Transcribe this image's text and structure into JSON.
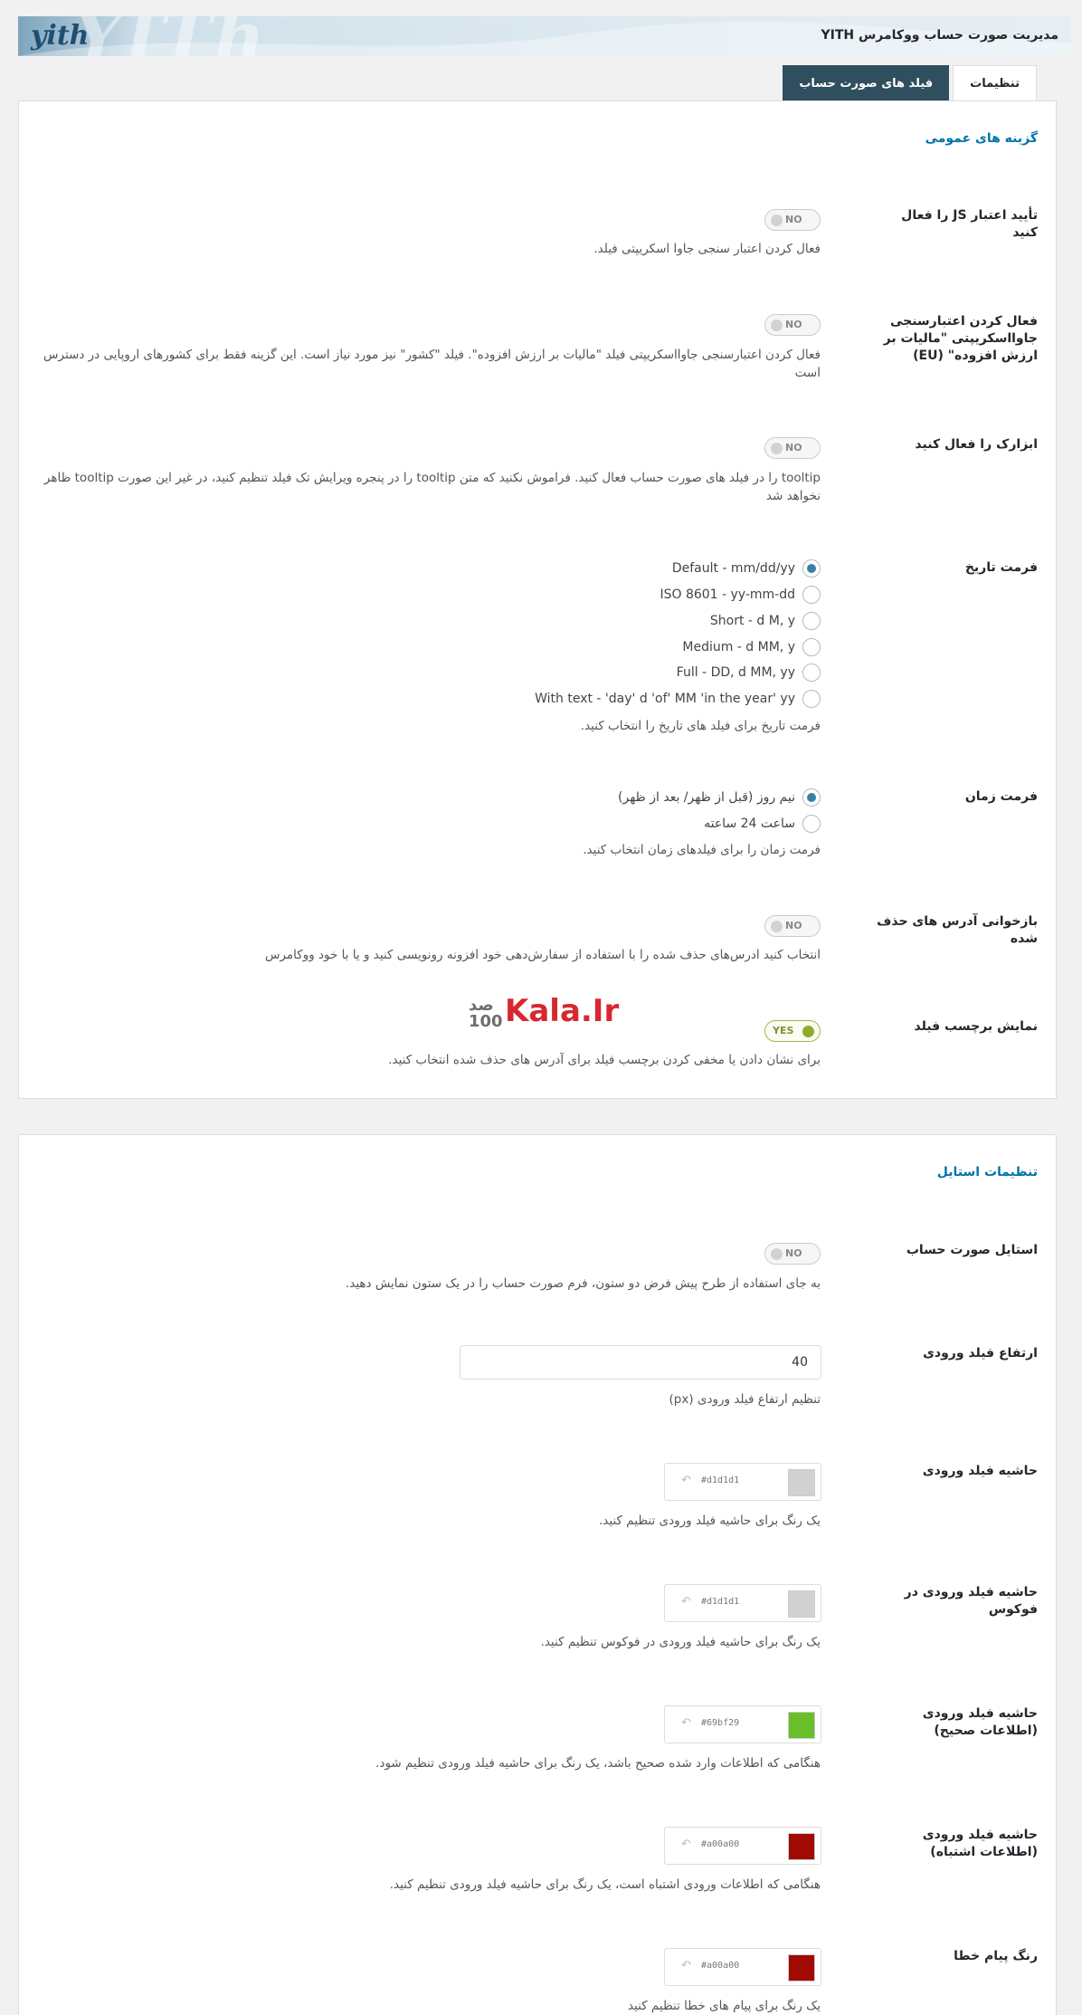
{
  "header": {
    "logo": "yith",
    "watermark": "YITh",
    "title": "مدیریت صورت حساب ووکامرس YITH"
  },
  "tabs": [
    {
      "label": "تنظیمات",
      "active": true
    },
    {
      "label": "فیلد های صورت حساب",
      "active": false
    }
  ],
  "general": {
    "section_title": "گزینه های عمومی",
    "js_validation": {
      "label": "تأیید اعتبار JS را فعال کنید",
      "toggle": "NO",
      "desc": "فعال کردن اعتبار سنجی جاوا اسکریپتی فیلد."
    },
    "vat_validation": {
      "label": "فعال کردن اعتبارسنجی جاوااسکریپتی \"مالیات بر ارزش افزوده\" (EU)",
      "toggle": "NO",
      "desc": "فعال کردن اعتبارسنجی جاوااسکریپتی فیلد \"مالیات بر ارزش افزوده\". فیلد \"کشور\" نیز مورد نیاز است. این گزینه فقط برای کشورهای اروپایی در دسترس است"
    },
    "tooltip": {
      "label": "ابزارک را فعال کنید",
      "toggle": "NO",
      "desc": "tooltip را در فیلد های صورت حساب فعال کنید. فراموش نکنید که متن tooltip را در پنجره ویرایش تک فیلد تنظیم کنید، در غیر این صورت tooltip ظاهر نخواهد شد"
    },
    "date_format": {
      "label": "فرمت تاریخ",
      "options": [
        {
          "label": "Default - mm/dd/yy",
          "checked": true
        },
        {
          "label": "ISO 8601 - yy-mm-dd",
          "checked": false
        },
        {
          "label": "Short - d M, y",
          "checked": false
        },
        {
          "label": "Medium - d MM, y",
          "checked": false
        },
        {
          "label": "Full - DD, d MM, yy",
          "checked": false
        },
        {
          "label": "With text - 'day' d 'of' MM 'in the year' yy",
          "checked": false
        }
      ],
      "desc": "فرمت تاریخ برای فیلد های تاریخ را انتخاب کنید."
    },
    "time_format": {
      "label": "فرمت زمان",
      "options": [
        {
          "label": "نیم روز (قبل از ظهر/ بعد از ظهر)",
          "checked": true
        },
        {
          "label": "ساعت 24 ساعته",
          "checked": false
        }
      ],
      "desc": "فرمت زمان را برای فیلدهای زمان انتخاب کنید."
    },
    "restore_address": {
      "label": "بازخوانی آدرس های حذف شده",
      "toggle": "NO",
      "desc": "انتخاب کنید ادرس‌های حذف شده را با استفاده از سفارش‌دهی خود افزونه رونویسی کنید و یا با خود ووکامرس"
    },
    "show_label": {
      "label": "نمایش برچسب فیلد",
      "toggle": "YES",
      "desc": "برای نشان دادن یا مخفی کردن برچسب فیلد برای آدرس های حذف شده انتخاب کنید."
    }
  },
  "style": {
    "section_title": "تنظیمات استایل",
    "invoice_style": {
      "label": "استایل صورت حساب",
      "toggle": "NO",
      "desc": "به جای استفاده از طرح پیش فرض دو ستون، فرم صورت حساب را در یک ستون نمایش دهید."
    },
    "input_height": {
      "label": "ارتفاع فیلد ورودی",
      "value": "40",
      "desc": "تنظیم ارتفاع فیلد ورودی (px)"
    },
    "input_border": {
      "label": "حاشیه فیلد ورودی",
      "hex": "#d1d1d1",
      "color": "#d1d1d1",
      "desc": "یک رنگ برای حاشیه فیلد ورودی تنظیم کنید."
    },
    "input_border_focus": {
      "label": "حاشیه فیلد ورودی در فوکوس",
      "hex": "#d1d1d1",
      "color": "#d1d1d1",
      "desc": "یک رنگ برای حاشیه فیلد ورودی در فوکوس تنظیم کنید."
    },
    "input_border_valid": {
      "label": "حاشیه فیلد ورودی (اطلاعات صحیح)",
      "hex": "#69bf29",
      "color": "#69bf29",
      "desc": "هنگامی که اطلاعات وارد شده صحیح باشد، یک رنگ برای حاشیه فیلد ورودی تنظیم شود."
    },
    "input_border_invalid": {
      "label": "حاشیه فیلد ورودی (اطلاعات اشتباه)",
      "hex": "#a00a00",
      "color": "#a00a00",
      "desc": "هنگامی که اطلاعات ورودی اشتباه است، یک رنگ برای حاشیه فیلد ورودی تنظیم کنید."
    },
    "error_color": {
      "label": "رنگ پیام خطا",
      "hex": "#a00a00",
      "color": "#a00a00",
      "desc": "یک رنگ برای پیام های خطا تنظیم کنید"
    }
  },
  "watermark_logo": {
    "part1": "صد",
    "part2": "Kala.Ir",
    "part1_latin": "100"
  }
}
